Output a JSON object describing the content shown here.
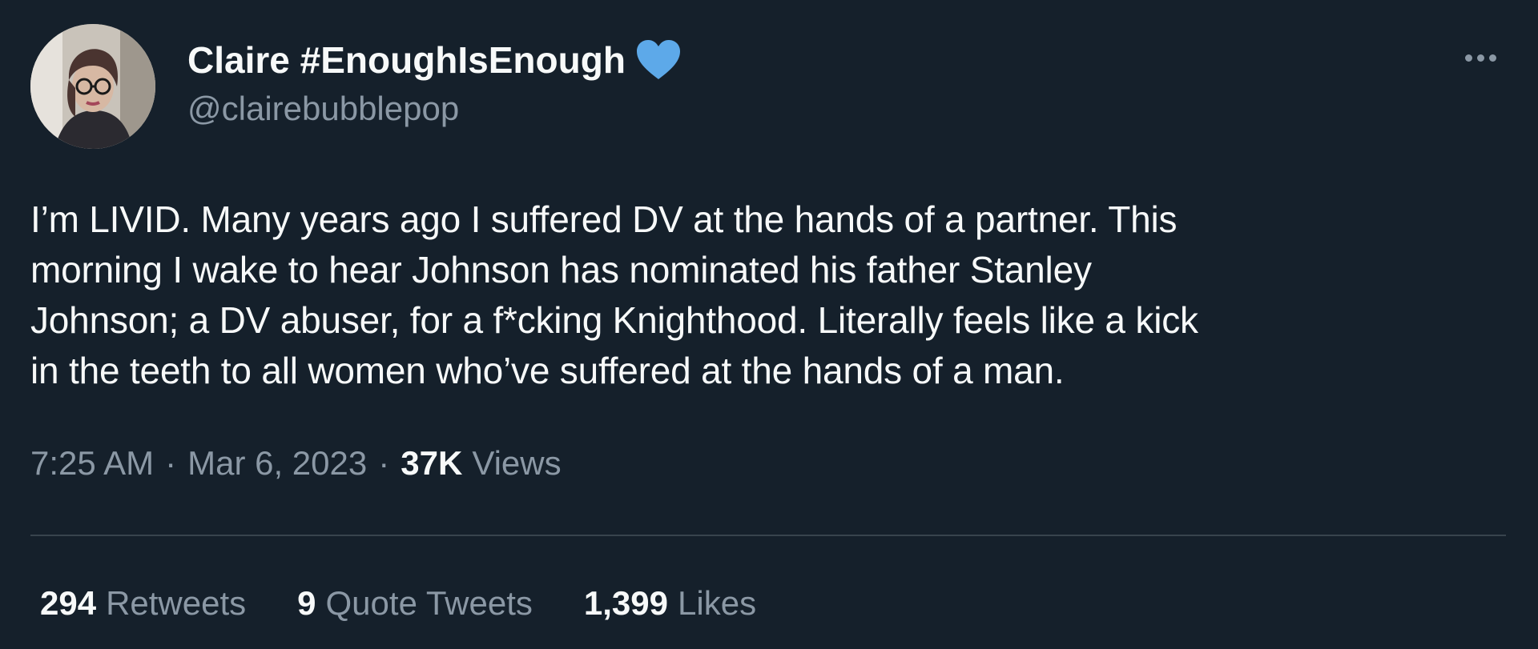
{
  "user": {
    "display_name": "Claire #EnoughIsEnough",
    "handle": "@clairebubblepop",
    "badge_icon": "blue-heart-icon",
    "badge_color": "#5da9e9"
  },
  "tweet": {
    "text": "I’m LIVID. Many years ago I suffered DV at the hands of a partner. This\nmorning I wake to hear Johnson has nominated his father Stanley\nJohnson; a DV abuser, for a f*cking Knighthood. Literally feels like a kick\nin the teeth to all women who’ve suffered at the hands of a man.",
    "time": "7:25 AM",
    "date": "Mar 6, 2023",
    "separator": "·",
    "views_count": "37K",
    "views_label": "Views"
  },
  "stats": {
    "retweets_count": "294",
    "retweets_label": "Retweets",
    "quotes_count": "9",
    "quotes_label": "Quote Tweets",
    "likes_count": "1,399",
    "likes_label": "Likes"
  },
  "colors": {
    "background": "#15202b",
    "primary_text": "#f7f9f9",
    "secondary_text": "#8b98a5",
    "divider": "#38444d"
  }
}
